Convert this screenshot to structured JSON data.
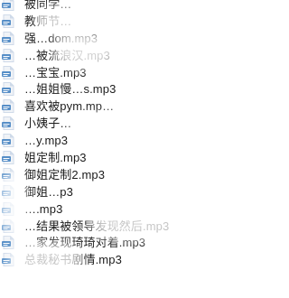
{
  "file_list": {
    "items": [
      {
        "name": "被同学…"
      },
      {
        "name": "教师节…"
      },
      {
        "name": "强…dom.mp3"
      },
      {
        "name": "…被流浪汉.mp3"
      },
      {
        "name": "…宝宝.mp3"
      },
      {
        "name": "…姐姐慢…s.mp3"
      },
      {
        "name": "喜欢被pym.mp…"
      },
      {
        "name": "小姨子…"
      },
      {
        "name": "…y.mp3"
      },
      {
        "name": "姐定制.mp3"
      },
      {
        "name": "御姐定制2.mp3"
      },
      {
        "name": "御姐…p3"
      },
      {
        "name": "….mp3"
      },
      {
        "name": "…结果被领导发现然后.mp3"
      },
      {
        "name": "…家发现琦琦对着.mp3"
      },
      {
        "name": "总裁秘书剧情.mp3"
      }
    ]
  },
  "icon_colors": {
    "paper": "#eef2f7",
    "fold": "#c9d6e6",
    "badge": "#3f7fc0",
    "badge_text": "#ffffff"
  }
}
